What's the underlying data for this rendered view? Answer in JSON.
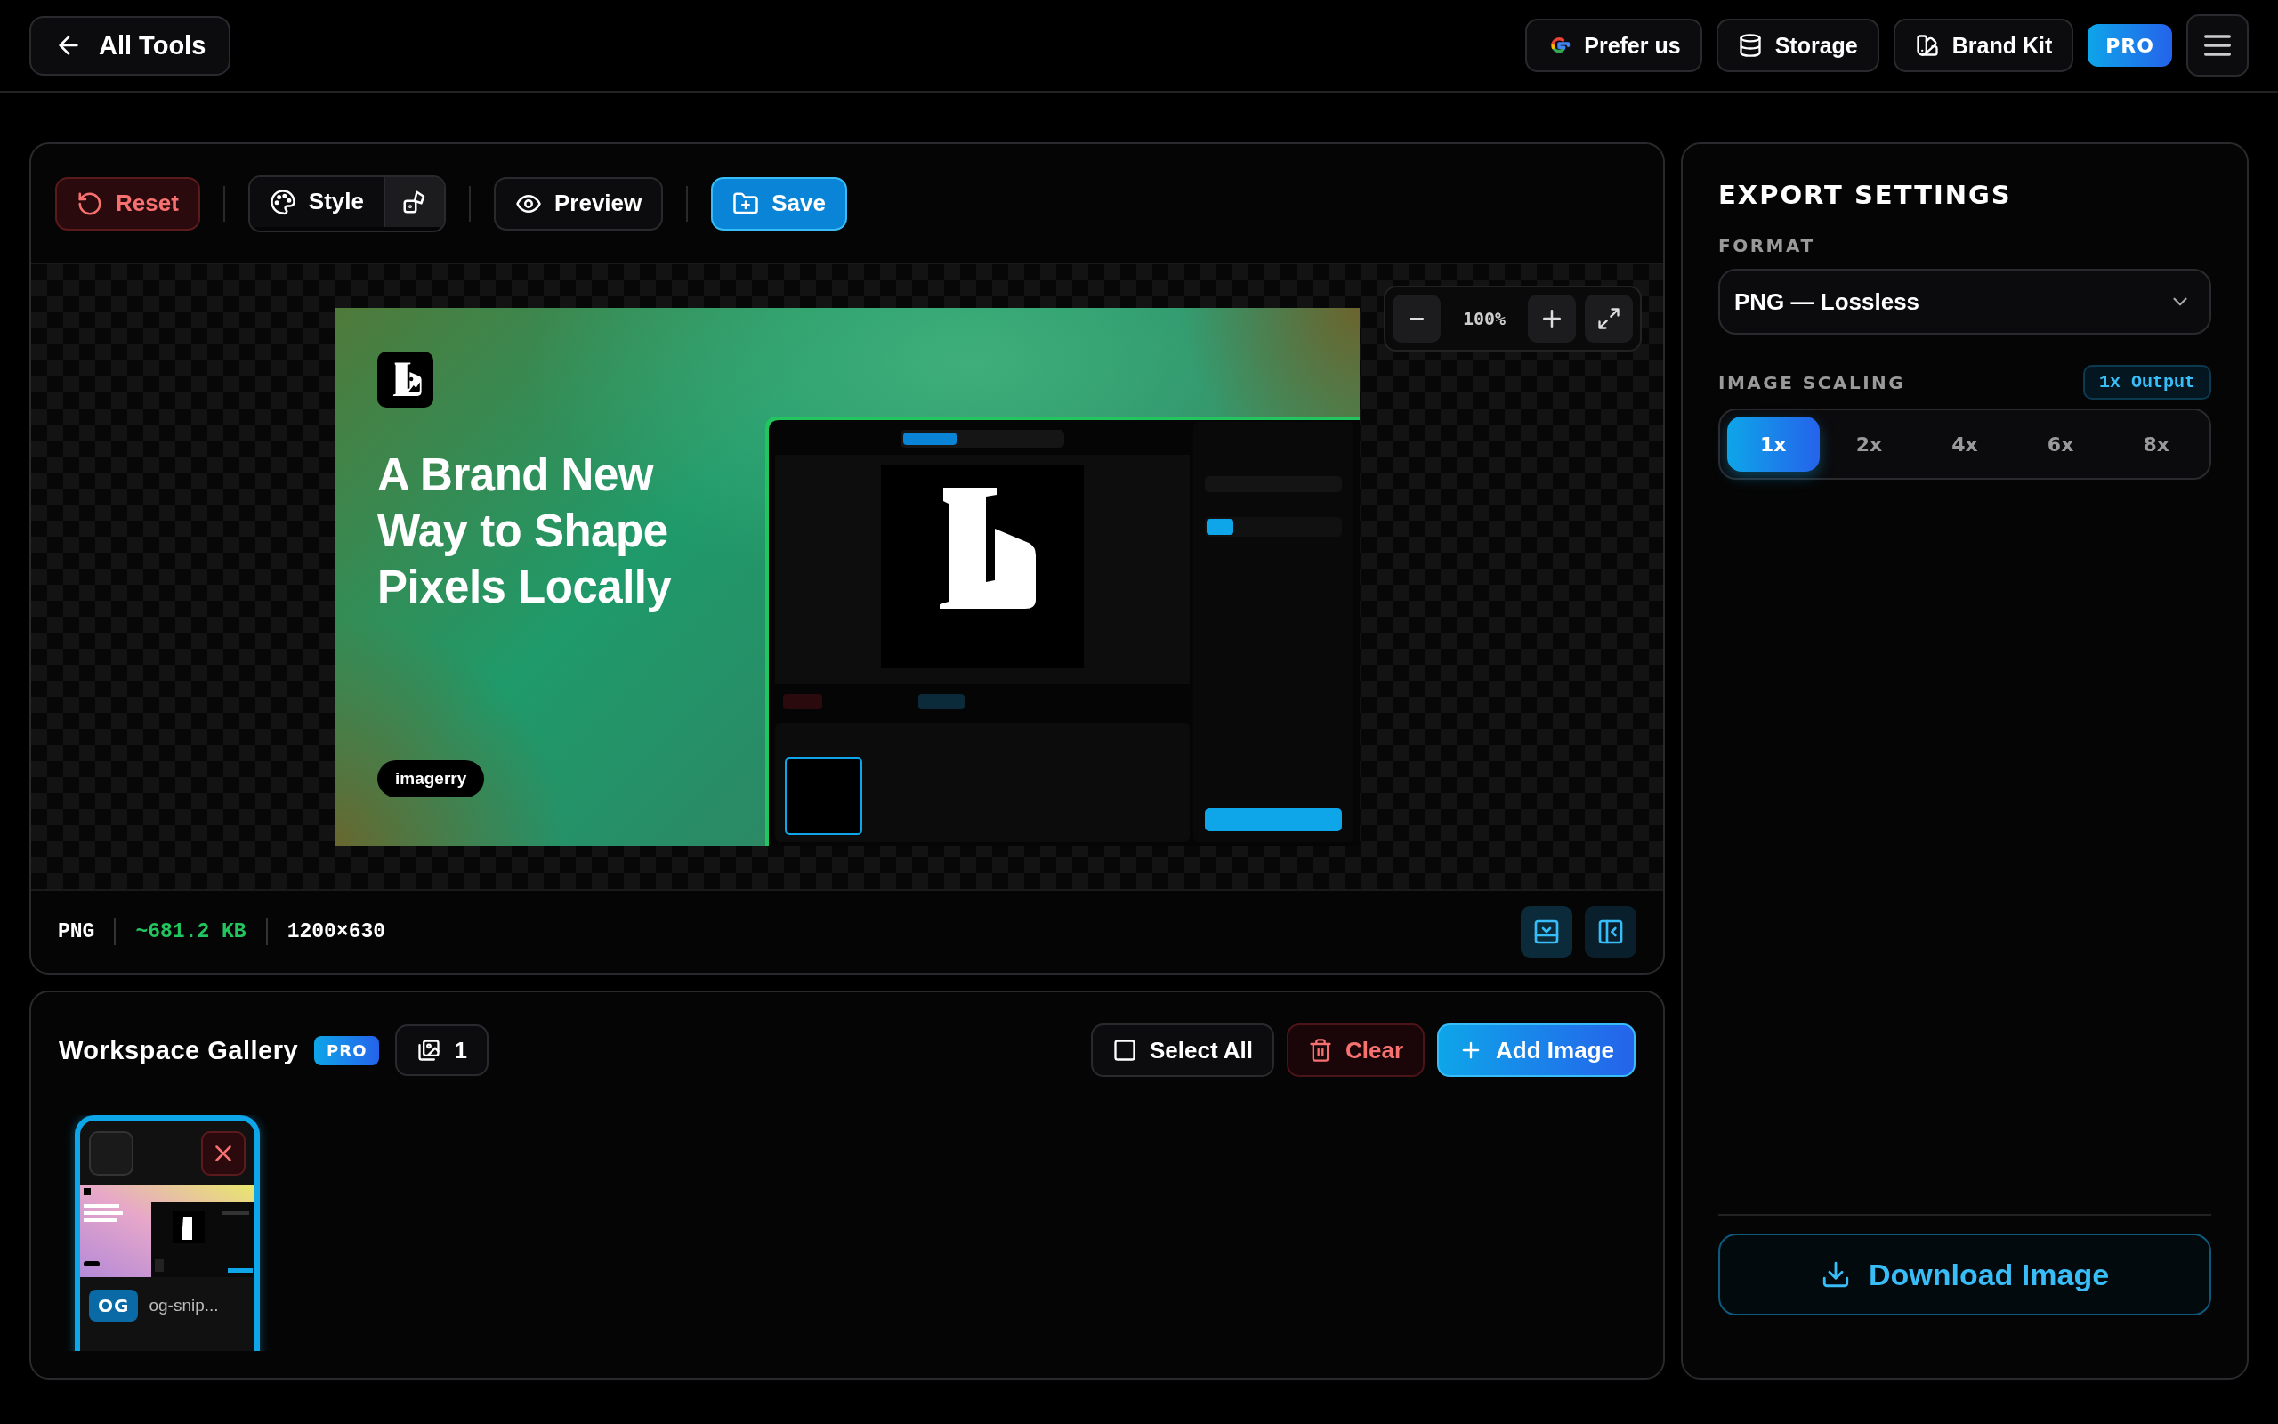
{
  "topbar": {
    "back": "All Tools",
    "actions": [
      {
        "kind": "google",
        "label": "Prefer us"
      },
      {
        "kind": "storage",
        "label": "Storage"
      },
      {
        "kind": "brand",
        "label": "Brand Kit"
      }
    ],
    "pro": "PRO"
  },
  "toolbar": {
    "reset": "Reset",
    "style": "Style",
    "preview": "Preview",
    "save": "Save"
  },
  "zoom": "100%",
  "og_image": {
    "heading": "A Brand New\nWay to Shape\nPixels Locally",
    "chip": "imagerry"
  },
  "info_bar": {
    "format": "PNG",
    "size": "~681.2 KB",
    "dimensions": "1200×630"
  },
  "gallery": {
    "title": "Workspace Gallery",
    "badge": "PRO",
    "count": "1",
    "select_all": {
      "label": "Select All",
      "checked": false
    },
    "clear": "Clear",
    "add": "Add Image",
    "items": [
      {
        "badge": "OG",
        "name": "og-snip...",
        "selected": true,
        "checked": false
      }
    ]
  },
  "export": {
    "title": "EXPORT SETTINGS",
    "format_label": "FORMAT",
    "format_value": "PNG — Lossless",
    "scaling_label": "IMAGE SCALING",
    "scaling_badge": "1x Output",
    "scales": [
      {
        "label": "1x",
        "selected": true
      },
      {
        "label": "2x",
        "selected": false
      },
      {
        "label": "4x",
        "selected": false
      },
      {
        "label": "6x",
        "selected": false
      },
      {
        "label": "8x",
        "selected": false
      }
    ],
    "download": "Download Image"
  }
}
